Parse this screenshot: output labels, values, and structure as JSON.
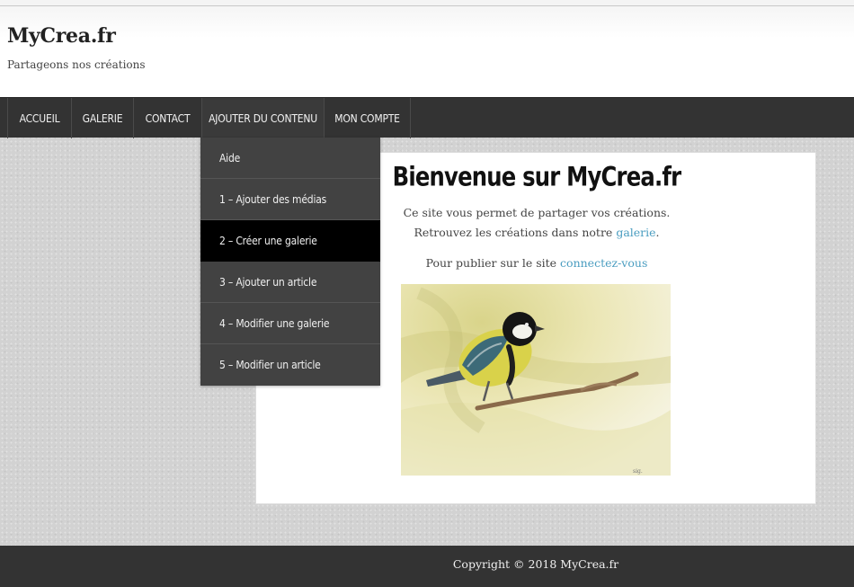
{
  "site": {
    "title": "MyCrea.fr",
    "tagline": "Partageons nos créations"
  },
  "nav": {
    "items": [
      {
        "label": "ACCUEIL"
      },
      {
        "label": "GALERIE"
      },
      {
        "label": "CONTACT"
      },
      {
        "label": "AJOUTER DU CONTENU"
      },
      {
        "label": "MON COMPTE"
      }
    ]
  },
  "dropdown": {
    "items": [
      {
        "label": "Aide"
      },
      {
        "label": "1 – Ajouter des médias"
      },
      {
        "label": "2 – Créer une galerie"
      },
      {
        "label": "3 – Ajouter un article"
      },
      {
        "label": "4 – Modifier une galerie"
      },
      {
        "label": "5 – Modifier un article"
      }
    ],
    "hovered_index": 2
  },
  "main": {
    "title": "Bienvenue sur MyCrea.fr",
    "line1": "Ce site vous permet de partager vos créations.",
    "line2_prefix": "Retrouvez les créations dans notre ",
    "line2_link": "galerie",
    "line2_suffix": ".",
    "line3_prefix": "Pour publier sur le site ",
    "line3_link": "connectez-vous",
    "image_alt": "Watercolor of a great tit bird on a branch"
  },
  "footer": {
    "copyright": "Copyright © 2018 MyCrea.fr"
  },
  "colors": {
    "nav_bg": "#333333",
    "dropdown_bg": "#424242",
    "dropdown_hover": "#000000",
    "link": "#4a9dc0",
    "footer_bg": "#333333"
  }
}
